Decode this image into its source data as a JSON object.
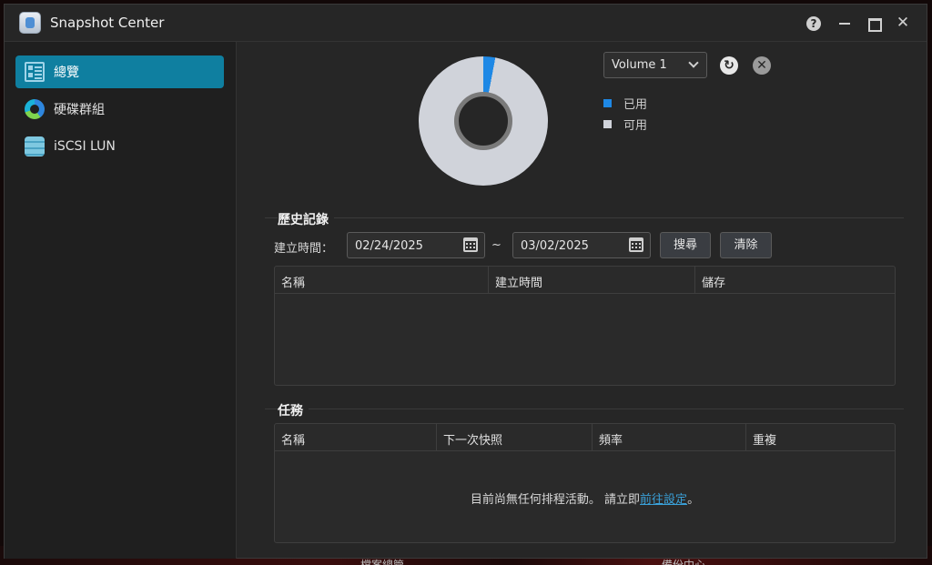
{
  "window": {
    "title": "Snapshot Center",
    "controls": {
      "help": "?",
      "close": "✕"
    }
  },
  "sidebar": {
    "items": [
      {
        "label": "總覽",
        "icon": "overview-icon",
        "active": true
      },
      {
        "label": "硬碟群組",
        "icon": "storage-pool-icon",
        "active": false
      },
      {
        "label": "iSCSI LUN",
        "icon": "iscsi-lun-icon",
        "active": false
      }
    ]
  },
  "overview": {
    "volume_select": "Volume 1",
    "refresh_icon": "refresh-icon",
    "clear_icon": "clear-icon",
    "usage_chart": {
      "used_fraction": 0.03,
      "used_color": "#1e88e5",
      "available_color": "#d0d3da"
    },
    "legend": [
      {
        "label": "已用",
        "color": "#1e88e5"
      },
      {
        "label": "可用",
        "color": "#d0d3da"
      }
    ]
  },
  "history": {
    "title": "歷史記錄",
    "created_label": "建立時間：",
    "date_from": "02/24/2025",
    "separator": "~",
    "date_to": "03/02/2025",
    "search_button": "搜尋",
    "clear_button": "清除",
    "columns": [
      "名稱",
      "建立時間",
      "儲存"
    ],
    "rows": []
  },
  "tasks": {
    "title": "任務",
    "columns": [
      "名稱",
      "下一次快照",
      "頻率",
      "重複"
    ],
    "empty_message_prefix": "目前尚無任何排程活動。 請立即",
    "empty_message_link": "前往設定",
    "empty_message_suffix": "。"
  },
  "desktop": {
    "left_text": "檔案總管",
    "right_text": "備份中心"
  }
}
